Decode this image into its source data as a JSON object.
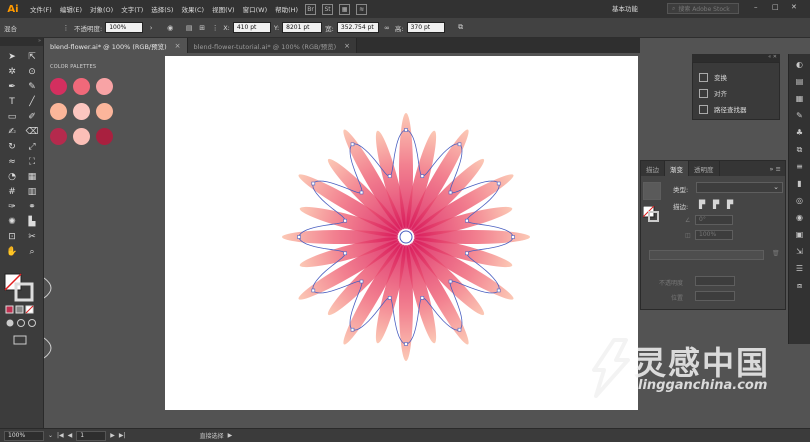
{
  "app": {
    "logo": "Ai"
  },
  "menu": {
    "items": [
      "文件(F)",
      "编辑(E)",
      "对象(O)",
      "文字(T)",
      "选择(S)",
      "效果(C)",
      "视图(V)",
      "窗口(W)",
      "帮助(H)"
    ]
  },
  "workspace_label": "基本功能",
  "stock_search_placeholder": "搜索 Adobe Stock",
  "control_bar": {
    "mode": "混合",
    "opacity_label": "不透明度:",
    "opacity_value": "100%",
    "x_label": "X:",
    "x_value": "410 pt",
    "y_label": "Y:",
    "y_value": "8201 pt",
    "w_label": "宽:",
    "w_value": "352.754 pt",
    "h_label": "高:",
    "h_value": "370 pt"
  },
  "tabs": [
    {
      "label": "blend-flower.ai* @ 100% (RGB/预览)",
      "close": "×"
    },
    {
      "label": "blend-flower-tutorial.ai* @ 100% (RGB/预览)",
      "close": "×"
    }
  ],
  "palette": {
    "title": "COLOR PALETTES",
    "rows": [
      [
        "#d42f5f",
        "#f0697a",
        "#f8a3a5"
      ],
      [
        "#fbb69a",
        "#fcc6c0",
        "#fbb59b"
      ],
      [
        "#b52a4d",
        "#fbbfb7",
        "#a9203f"
      ]
    ]
  },
  "dock": {
    "items": [
      {
        "label": "变换"
      },
      {
        "label": "对齐"
      },
      {
        "label": "路径查找器"
      }
    ]
  },
  "gradient_panel": {
    "tabs": [
      "描边",
      "渐变",
      "透明度"
    ],
    "type_label": "类型:",
    "stroke_label": "描边:",
    "opacity_label": "不透明度",
    "position_label": "位置",
    "angle_value": "0°",
    "ratio_value": "100%"
  },
  "status": {
    "zoom": "100%",
    "page": "1",
    "tool": "直接选择"
  },
  "watermark": {
    "cn": "灵感中国",
    "en": "lingganchina.com"
  },
  "colors": {
    "accent": "#e8426f",
    "path_stroke": "#4a5fc0"
  }
}
